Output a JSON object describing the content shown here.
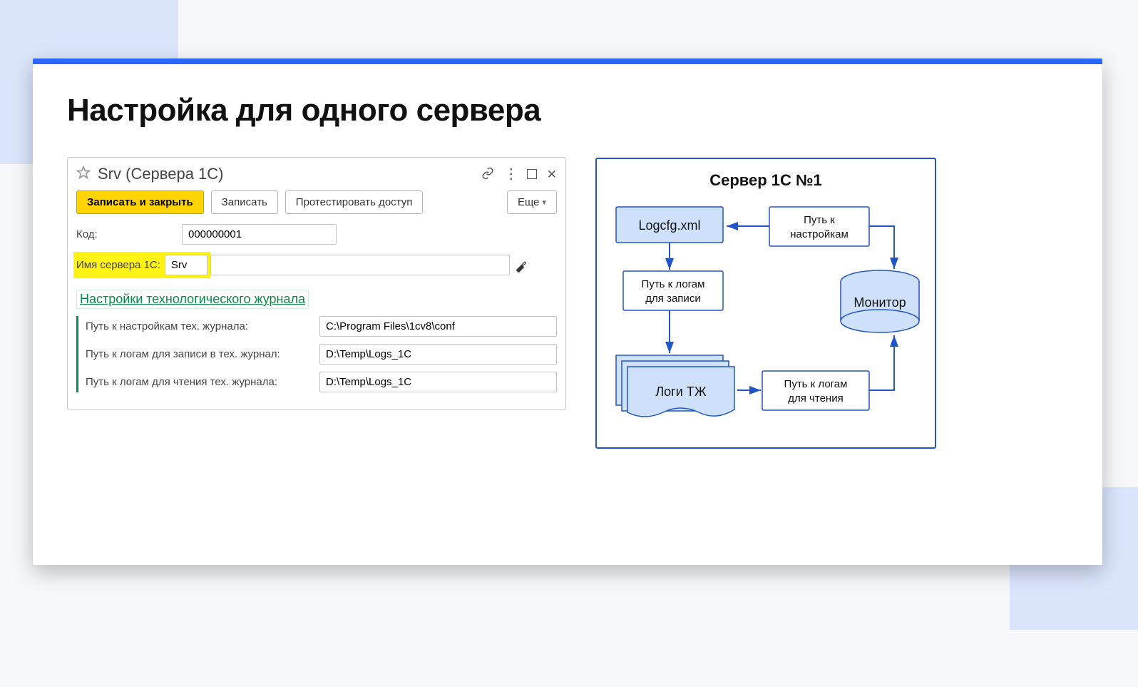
{
  "slide": {
    "title": "Настройка для одного сервера"
  },
  "window": {
    "title": "Srv (Сервера 1С)",
    "toolbar": {
      "save_close": "Записать и закрыть",
      "save": "Записать",
      "test": "Протестировать доступ",
      "more": "Еще"
    },
    "fields": {
      "code_label": "Код:",
      "code_value": "000000001",
      "server_name_label": "Имя сервера 1С:",
      "server_name_value": "Srv"
    },
    "section_title": "Настройки технологического журнала",
    "tj": {
      "settings_path_label": "Путь к настройкам тех. журнала:",
      "settings_path_value": "C:\\Program Files\\1cv8\\conf",
      "write_path_label": "Путь к логам для записи в тех. журнал:",
      "write_path_value": "D:\\Temp\\Logs_1C",
      "read_path_label": "Путь к логам для чтения тех. журнала:",
      "read_path_value": "D:\\Temp\\Logs_1C"
    }
  },
  "diagram": {
    "title": "Сервер 1С №1",
    "logcfg": "Logcfg.xml",
    "settings_path_line1": "Путь к",
    "settings_path_line2": "настройкам",
    "write_path_line1": "Путь к логам",
    "write_path_line2": "для записи",
    "monitor": "Монитор",
    "logs": "Логи ТЖ",
    "read_path_line1": "Путь к логам",
    "read_path_line2": "для чтения"
  }
}
